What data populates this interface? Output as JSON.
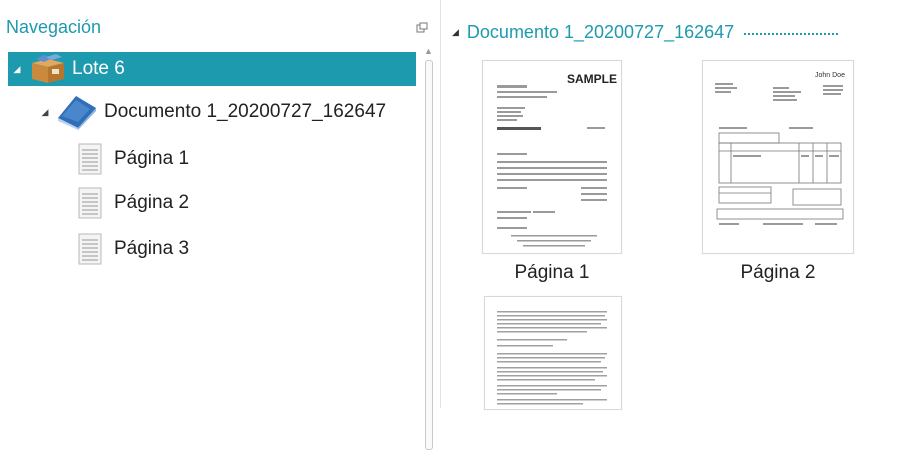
{
  "navigation": {
    "title": "Navegación",
    "tree": {
      "batch_label": "Lote 6",
      "document_label": "Documento 1_20200727_162647",
      "pages": [
        "Página 1",
        "Página 2",
        "Página 3"
      ]
    }
  },
  "content": {
    "document_title": "Documento 1_20200727_162647",
    "thumbnails": [
      {
        "caption": "Página 1",
        "watermark": "SAMPLE"
      },
      {
        "caption": "Página 2",
        "letterhead": "John Doe"
      },
      {
        "caption": ""
      }
    ]
  },
  "colors": {
    "accent": "#1d9aae",
    "selection_text": "#ffffff"
  },
  "icons": [
    "batch-box-icon",
    "document-book-icon",
    "page-icon",
    "pin-icon",
    "expand-caret-icon",
    "scroll-up-icon"
  ]
}
